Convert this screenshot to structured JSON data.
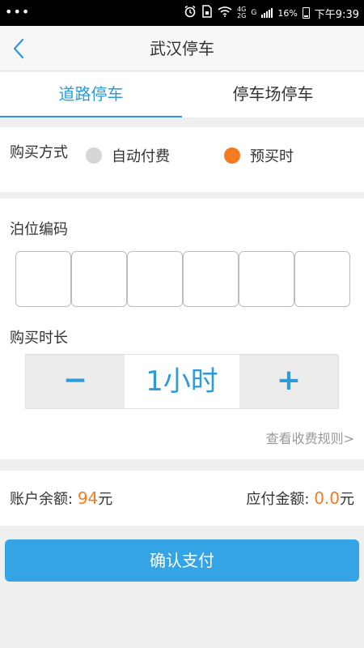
{
  "status_bar": {
    "dots": "•••",
    "network_top": "4G",
    "network_bottom": "2G",
    "network_g": "G",
    "battery": "16%",
    "time": "下午9:39",
    "alarm_icon": "alarm-clock-icon",
    "sim_icon": "sim-card-icon",
    "wifi_icon": "wifi-icon"
  },
  "header": {
    "title": "武汉停车",
    "back_icon": "chevron-left-icon"
  },
  "tabs": [
    {
      "label": "道路停车",
      "active": true
    },
    {
      "label": "停车场停车",
      "active": false
    }
  ],
  "purchase": {
    "label": "购买方式",
    "options": [
      {
        "label": "自动付费",
        "selected": false
      },
      {
        "label": "预买时",
        "selected": true
      }
    ]
  },
  "berth": {
    "label": "泊位编码",
    "digits": [
      "",
      "",
      "",
      "",
      "",
      ""
    ]
  },
  "duration": {
    "label": "购买时长",
    "minus": "−",
    "plus": "+",
    "value": "1小时"
  },
  "rules_link": "查看收费规则>",
  "balance": {
    "label": "账户余额:",
    "amount": "94",
    "unit": "元"
  },
  "payable": {
    "label": "应付金额:",
    "amount": "0.0",
    "unit": "元"
  },
  "confirm_button": "确认支付",
  "colors": {
    "accent": "#2e9ad7",
    "orange": "#f47b20",
    "button": "#35a4e5"
  }
}
